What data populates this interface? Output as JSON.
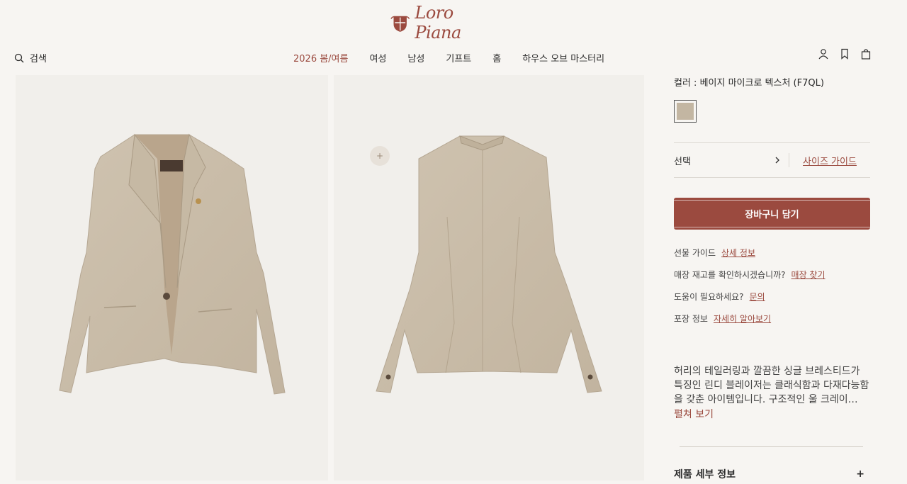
{
  "header": {
    "brand": "Loro Piana",
    "search_label": "검색",
    "nav": [
      {
        "label": "2026 봄/여름",
        "active": true
      },
      {
        "label": "여성",
        "active": false
      },
      {
        "label": "남성",
        "active": false
      },
      {
        "label": "기프트",
        "active": false
      },
      {
        "label": "홈",
        "active": false
      },
      {
        "label": "하우스 오브 마스터리",
        "active": false
      }
    ],
    "icons": [
      "user-icon",
      "bookmark-icon",
      "shopping-bag-icon"
    ]
  },
  "gallery": {
    "zoom_label": "+"
  },
  "product": {
    "color_label": "컬러 : 베이지 마이크로 텍스처 (F7QL)",
    "swatch_color": "#c3b6a2",
    "select_label": "선택",
    "size_guide": "사이즈 가이드",
    "add_to_cart": "장바구니 담기",
    "info": [
      {
        "label": "선물 가이드",
        "link": "상세 정보"
      },
      {
        "label": "매장 재고를 확인하시겠습니까?",
        "link": "매장 찾기"
      },
      {
        "label": "도움이 필요하세요?",
        "link": "문의"
      },
      {
        "label": "포장 정보",
        "link": "자세히 알아보기"
      }
    ],
    "description": "허리의 테일러링과 깔끔한 싱글 브레스티드가 특징인 린디 블레이저는 클래식함과 다재다능함을 갖춘 아이템입니다. 구조적인 울 크레이…",
    "read_more": "펼쳐 보기",
    "details_label": "제품 세부 정보",
    "details_toggle": "+"
  },
  "colors": {
    "accent": "#9b4a3f",
    "background": "#f7f5f2",
    "jacket": "#c9bca8"
  }
}
